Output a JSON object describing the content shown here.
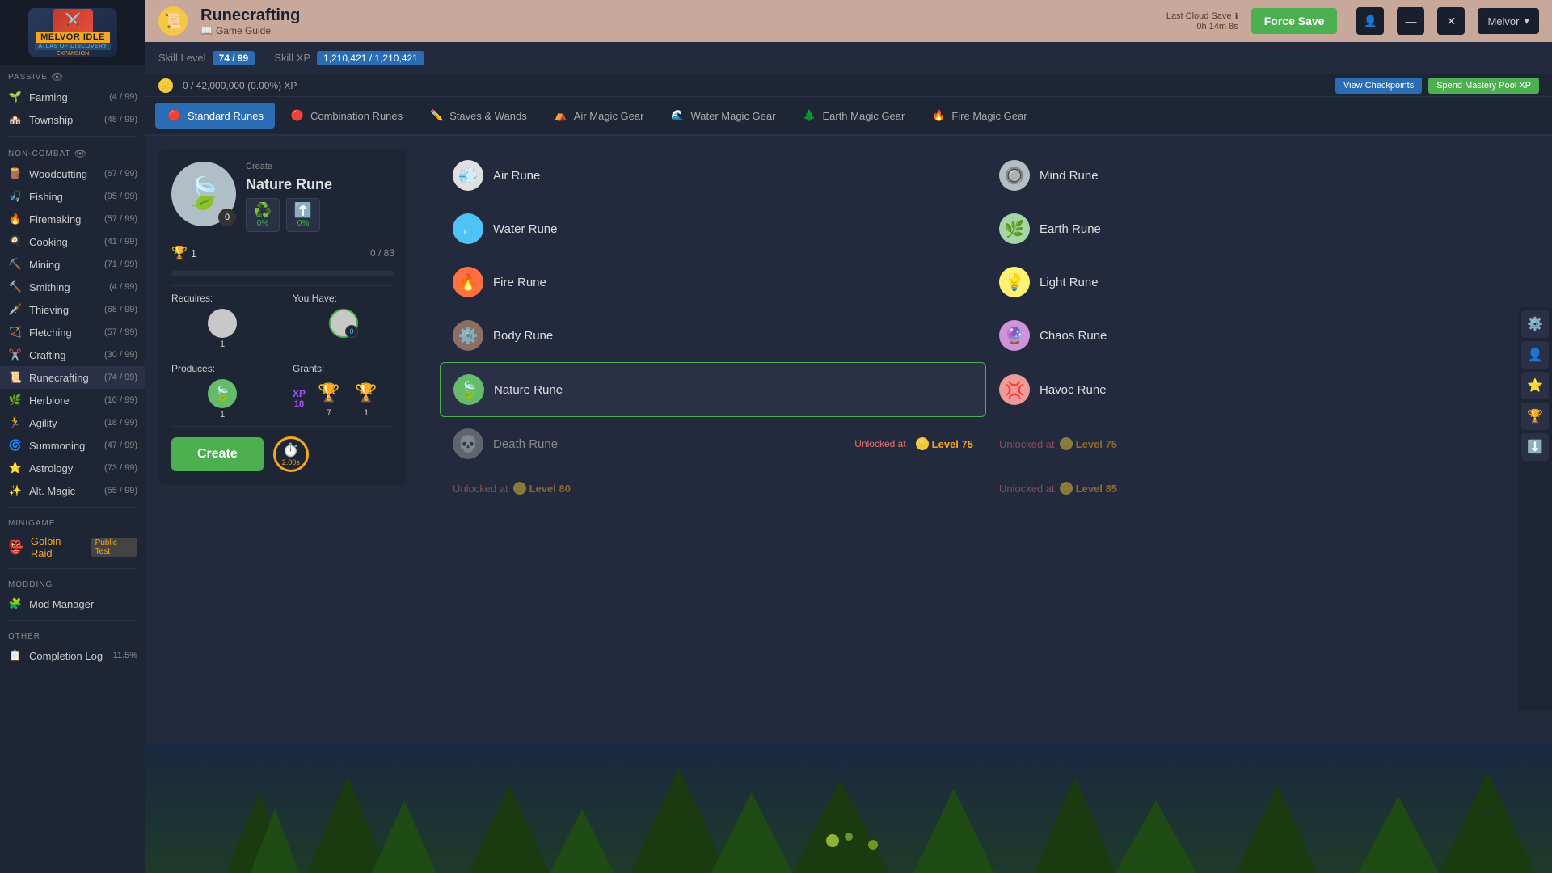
{
  "app": {
    "title": "Melvor Idle",
    "subtitle": "Atlas of Discovery"
  },
  "header": {
    "skill_name": "Runecrafting",
    "guide_label": "Game Guide",
    "cloud_save_label": "Last Cloud Save",
    "cloud_save_time": "0h 14m 8s",
    "force_save_label": "Force Save",
    "user_name": "Melvor",
    "icon": "📜"
  },
  "skill_bar": {
    "level_label": "Skill Level",
    "level_value": "74 / 99",
    "xp_label": "Skill XP",
    "xp_value": "1,210,421 / 1,210,421"
  },
  "xp_bar": {
    "current": "0 / 42,000,000 (0.00%) XP",
    "view_checkpoints": "View Checkpoints",
    "spend_mastery": "Spend Mastery Pool XP"
  },
  "nav_tabs": [
    {
      "id": "standard-runes",
      "label": "Standard Runes",
      "icon": "🔴",
      "active": true
    },
    {
      "id": "combination-runes",
      "label": "Combination Runes",
      "icon": "🔴"
    },
    {
      "id": "staves-wands",
      "label": "Staves & Wands",
      "icon": "✏️"
    },
    {
      "id": "air-magic-gear",
      "label": "Air Magic Gear",
      "icon": "⛺"
    },
    {
      "id": "water-magic-gear",
      "label": "Water Magic Gear",
      "icon": "🌊"
    },
    {
      "id": "earth-magic-gear",
      "label": "Earth Magic Gear",
      "icon": "🌲"
    },
    {
      "id": "fire-magic-gear",
      "label": "Fire Magic Gear",
      "icon": "🔥"
    }
  ],
  "craft_card": {
    "create_label": "Create",
    "item_name": "Nature Rune",
    "item_icon": "🍃",
    "item_quantity": "0",
    "btn1_pct": "0%",
    "btn2_pct": "0%",
    "mastery_label": "1",
    "progress_current": "0",
    "progress_max": "83",
    "progress_pct": 0,
    "requires_label": "Requires:",
    "you_have_label": "You Have:",
    "requires_qty": "1",
    "have_qty": "0",
    "produces_label": "Produces:",
    "grants_label": "Grants:",
    "produces_qty": "1",
    "xp_amount": "18",
    "xp_label": "XP",
    "grant1_qty": "7",
    "grant2_qty": "1",
    "create_btn_label": "Create",
    "timer_value": "2.00s"
  },
  "runes": [
    {
      "id": "air-rune",
      "name": "Air Rune",
      "color": "#e0e0e0",
      "locked": false,
      "selected": false,
      "icon": "💨"
    },
    {
      "id": "mind-rune",
      "name": "Mind Rune",
      "color": "#b0bec5",
      "locked": false,
      "selected": false,
      "icon": "🔘"
    },
    {
      "id": "water-rune",
      "name": "Water Rune",
      "color": "#4fc3f7",
      "locked": false,
      "selected": false,
      "icon": "💧"
    },
    {
      "id": "earth-rune",
      "name": "Earth Rune",
      "color": "#a5d6a7",
      "locked": false,
      "selected": false,
      "icon": "🌿"
    },
    {
      "id": "fire-rune",
      "name": "Fire Rune",
      "color": "#ff7043",
      "locked": false,
      "selected": false,
      "icon": "🔥"
    },
    {
      "id": "light-rune",
      "name": "Light Rune",
      "color": "#fff176",
      "locked": false,
      "selected": false,
      "icon": "💡"
    },
    {
      "id": "body-rune",
      "name": "Body Rune",
      "color": "#8d6e63",
      "locked": false,
      "selected": false,
      "icon": "⚙️"
    },
    {
      "id": "chaos-rune",
      "name": "Chaos Rune",
      "color": "#ce93d8",
      "locked": false,
      "selected": false,
      "icon": "🔮"
    },
    {
      "id": "nature-rune",
      "name": "Nature Rune",
      "color": "#66bb6a",
      "locked": false,
      "selected": true,
      "icon": "🍃"
    },
    {
      "id": "havoc-rune",
      "name": "Havoc Rune",
      "color": "#ef9a9a",
      "locked": false,
      "selected": false,
      "icon": "💢"
    },
    {
      "id": "death-rune",
      "name": "Death Rune",
      "color": "#9e9e9e",
      "locked": false,
      "unlock_text": "Unlocked at",
      "unlock_level": "Level 75",
      "icon": "💀"
    },
    {
      "id": "death-rune-2",
      "name": "",
      "color": "#f5c842",
      "locked": true,
      "unlock_text": "Unlocked at",
      "unlock_level": "Level 75",
      "icon": ""
    },
    {
      "id": "locked-80",
      "name": "",
      "locked": true,
      "unlock_text": "Unlocked at",
      "unlock_level": "Level 80",
      "left": true
    },
    {
      "id": "locked-85",
      "name": "",
      "locked": true,
      "unlock_text": "Unlocked at",
      "unlock_level": "Level 85",
      "right": true
    }
  ],
  "sidebar": {
    "passive_label": "PASSIVE",
    "non_combat_label": "NON-COMBAT",
    "minigame_label": "MINIGAME",
    "modding_label": "MODDING",
    "other_label": "OTHER",
    "passive_items": [
      {
        "id": "farming",
        "label": "Farming",
        "count": "4 / 99",
        "icon": "🌱"
      },
      {
        "id": "township",
        "label": "Township",
        "count": "48 / 99",
        "icon": "🏘️"
      }
    ],
    "non_combat_items": [
      {
        "id": "woodcutting",
        "label": "Woodcutting",
        "count": "67 / 99",
        "icon": "🪵"
      },
      {
        "id": "fishing",
        "label": "Fishing",
        "count": "95 / 99",
        "icon": "🎣"
      },
      {
        "id": "firemaking",
        "label": "Firemaking",
        "count": "57 / 99",
        "icon": "🔥"
      },
      {
        "id": "cooking",
        "label": "Cooking",
        "count": "41 / 99",
        "icon": "🍳"
      },
      {
        "id": "mining",
        "label": "Mining",
        "count": "71 / 99",
        "icon": "⛏️"
      },
      {
        "id": "smithing",
        "label": "Smithing",
        "count": "4 / 99",
        "icon": "🔨"
      },
      {
        "id": "thieving",
        "label": "Thieving",
        "count": "68 / 99",
        "icon": "🗡️"
      },
      {
        "id": "fletching",
        "label": "Fletching",
        "count": "57 / 99",
        "icon": "🏹"
      },
      {
        "id": "crafting",
        "label": "Crafting",
        "count": "30 / 99",
        "icon": "✂️"
      },
      {
        "id": "runecrafting",
        "label": "Runecrafting",
        "count": "74 / 99",
        "icon": "📜",
        "active": true
      },
      {
        "id": "herblore",
        "label": "Herblore",
        "count": "10 / 99",
        "icon": "🌿"
      },
      {
        "id": "agility",
        "label": "Agility",
        "count": "18 / 99",
        "icon": "🏃"
      },
      {
        "id": "summoning",
        "label": "Summoning",
        "count": "47 / 99",
        "icon": "🌀"
      },
      {
        "id": "astrology",
        "label": "Astrology",
        "count": "73 / 99",
        "icon": "⭐"
      },
      {
        "id": "alt-magic",
        "label": "Alt. Magic",
        "count": "55 / 99",
        "icon": "✨"
      }
    ],
    "golbin_label": "Golbin Raid",
    "golbin_badge": "Public Test",
    "mod_manager_label": "Mod Manager",
    "other_items": [
      {
        "id": "completion-log",
        "label": "Completion Log",
        "count": "11.5%"
      }
    ]
  },
  "floating_btns": [
    "⚙️",
    "👤",
    "⭐",
    "🏆",
    "⬇️"
  ]
}
